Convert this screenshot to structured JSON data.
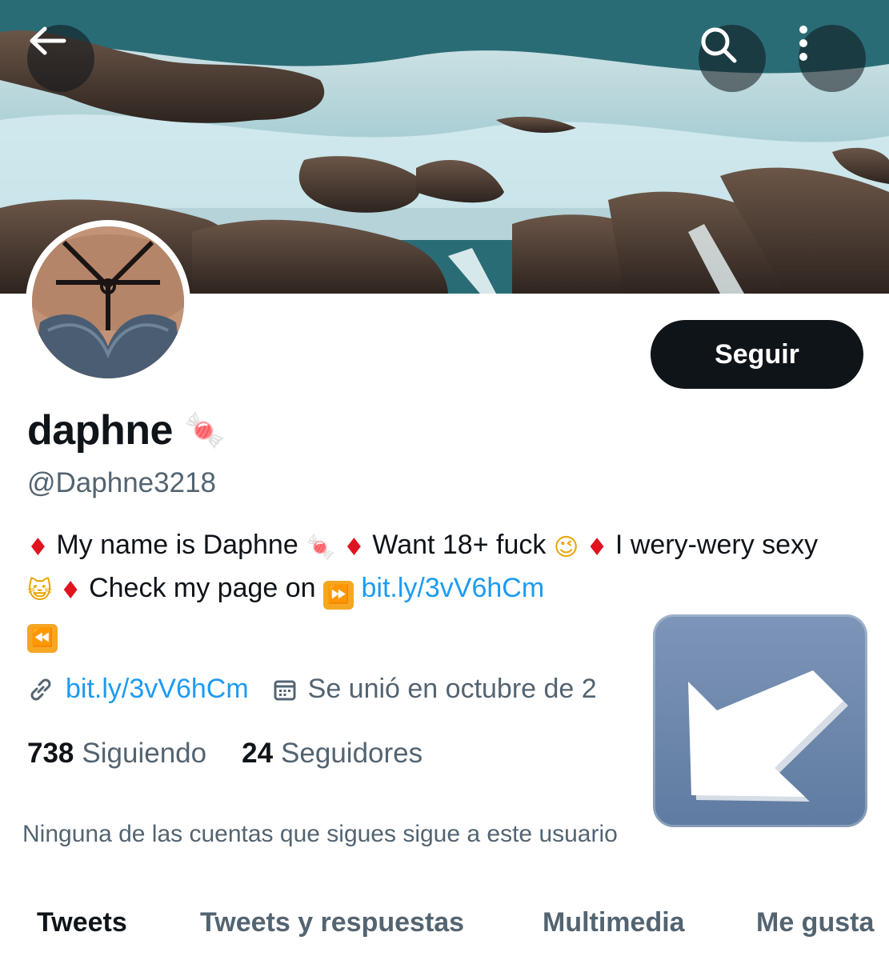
{
  "header": {
    "back_icon": "arrow-left-icon",
    "search_icon": "search-icon",
    "more_icon": "more-vertical-icon"
  },
  "profile": {
    "display_name": "daphne",
    "name_emoji": "🍬",
    "handle": "@Daphne3218",
    "follow_label": "Seguir"
  },
  "bio": {
    "part1": "My name is Daphne",
    "emoji_candy": "🍬",
    "part2": "Want 18+ fuck",
    "emoji_wink": "😉",
    "part3": "I wery-wery sexy",
    "emoji_cat": "😺",
    "part4": "Check my page on",
    "link": "bit.ly/3vV6hCm",
    "diamond": "♦",
    "ff": "⏩",
    "rw": "⏪"
  },
  "meta": {
    "link": "bit.ly/3vV6hCm",
    "joined": "Se unió en octubre de 2"
  },
  "stats": {
    "following_count": "738",
    "following_label": "Siguiendo",
    "followers_count": "24",
    "followers_label": "Seguidores"
  },
  "notice": "Ninguna de las cuentas que sigues sigue a este usuario",
  "tabs": [
    {
      "label": "Tweets",
      "active": true
    },
    {
      "label": "Tweets y respuestas",
      "active": false
    },
    {
      "label": "Multimedia",
      "active": false
    },
    {
      "label": "Me gusta",
      "active": false
    }
  ],
  "colors": {
    "link": "#1d9bf0",
    "text": "#0f1419",
    "secondary": "#536471",
    "diamond": "#e0141e",
    "sticker": "#6a84aa"
  }
}
